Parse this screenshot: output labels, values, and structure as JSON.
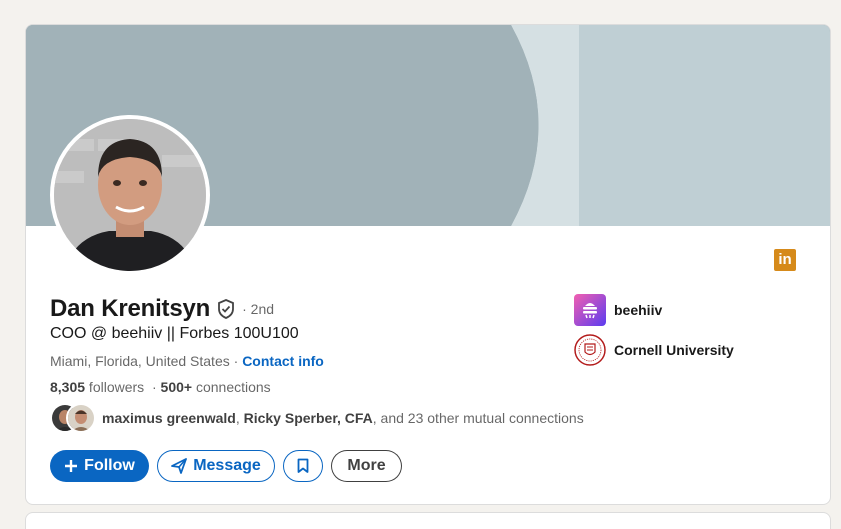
{
  "profile": {
    "name": "Dan Krenitsyn",
    "degree": "· 2nd",
    "headline": "COO @ beehiiv || Forbes 100U100",
    "location": "Miami, Florida, United States",
    "location_separator": " · ",
    "contact_info": "Contact info",
    "followers_count": "8,305",
    "followers_label": " followers",
    "connections_count": "500+",
    "connections_label": " connections",
    "connections_prefix": "  · ",
    "mutual": {
      "name1": "maximus greenwald",
      "separator": ", ",
      "name2": "Ricky Sperber, CFA",
      "suffix": ", and 23 other mutual connections"
    }
  },
  "actions": {
    "follow": "Follow",
    "message": "Message",
    "more": "More"
  },
  "organizations": [
    {
      "name": "beehiiv",
      "icon": "beehiiv-logo"
    },
    {
      "name": "Cornell University",
      "icon": "cornell-seal"
    }
  ],
  "colors": {
    "accent": "#0a66c2",
    "banner": "#a1b2b8",
    "linkedin_badge": "#d68a1a"
  },
  "icons": [
    "verified-shield-icon",
    "linkedin-icon",
    "plus-icon",
    "send-icon",
    "bookmark-icon"
  ]
}
